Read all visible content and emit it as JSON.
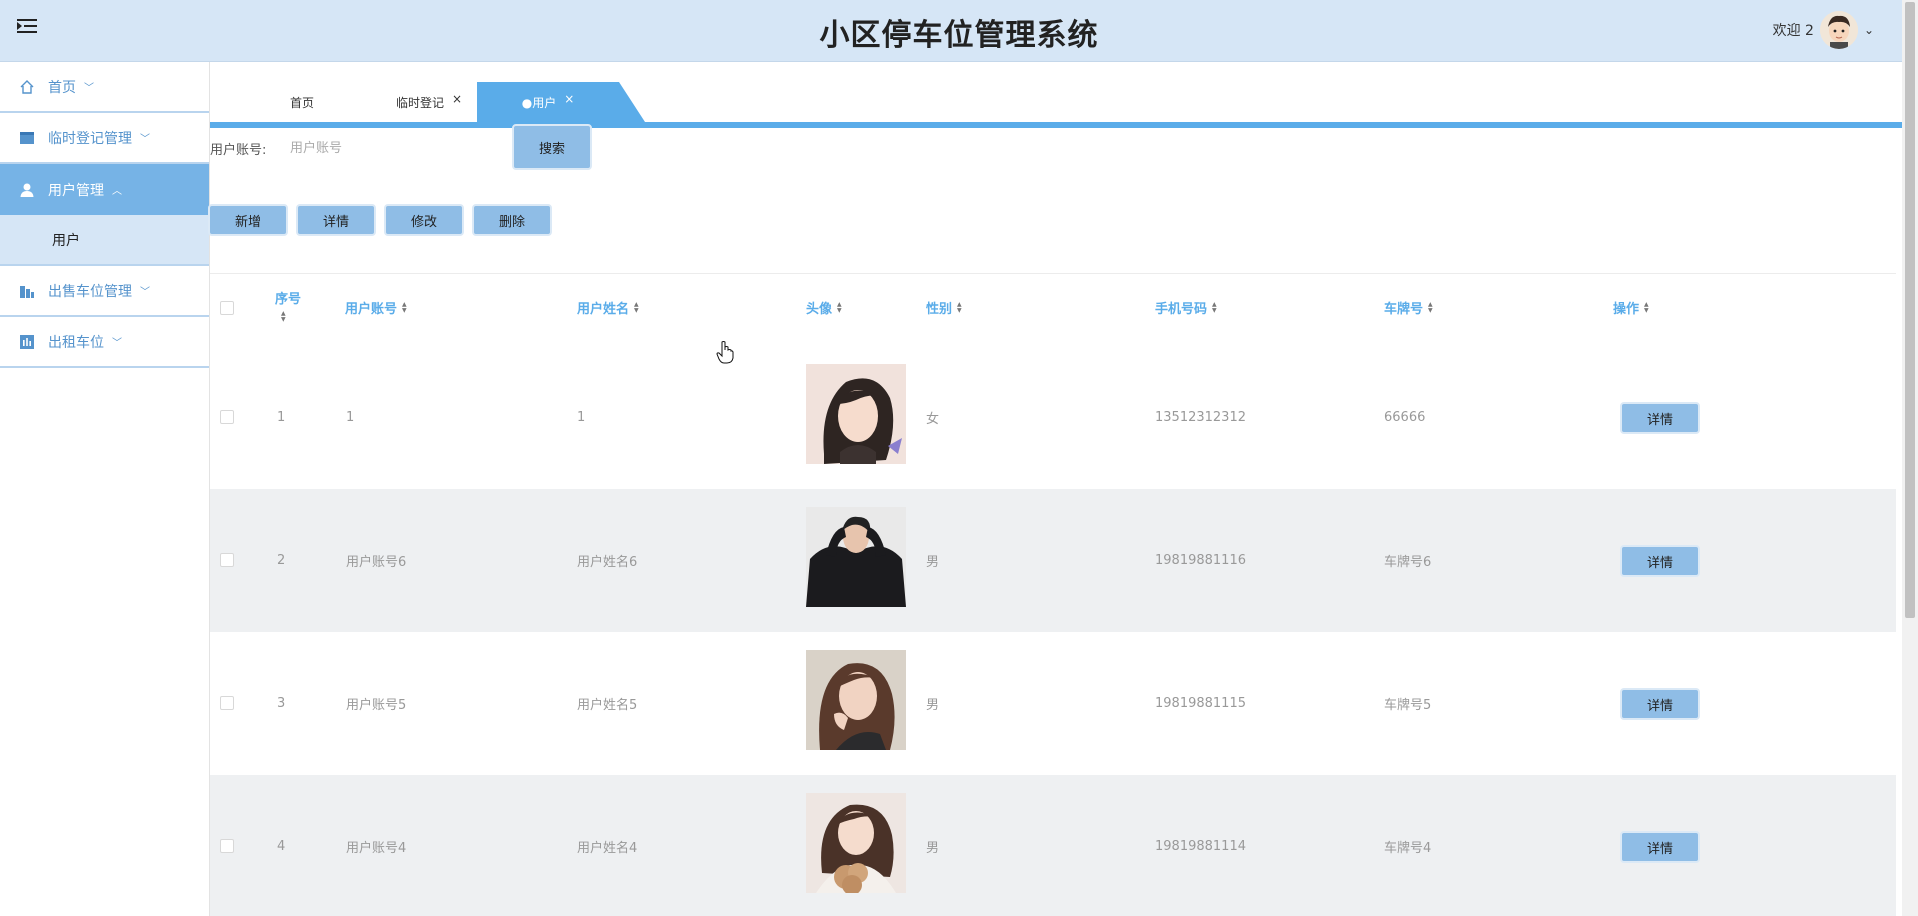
{
  "header": {
    "title": "小区停车位管理系统",
    "welcome": "欢迎 2",
    "caret": "⌄"
  },
  "sidebar": {
    "items": [
      {
        "label": "首页",
        "icon": "home-icon"
      },
      {
        "label": "临时登记管理",
        "icon": "register-icon"
      },
      {
        "label": "用户管理",
        "icon": "user-icon",
        "active": true,
        "sub": [
          {
            "label": "用户"
          }
        ]
      },
      {
        "label": "出售车位管理",
        "icon": "building-icon"
      },
      {
        "label": "出租车位",
        "icon": "rent-icon"
      }
    ]
  },
  "tabs": [
    {
      "label": "首页",
      "closable": false
    },
    {
      "label": "临时登记",
      "closable": true
    },
    {
      "label": "●用户",
      "closable": true,
      "active": true
    }
  ],
  "tab_close": "×",
  "search": {
    "label": "用户账号:",
    "placeholder": "用户账号",
    "button": "搜索"
  },
  "actions": {
    "add": "新增",
    "detail": "详情",
    "edit": "修改",
    "delete": "删除"
  },
  "table": {
    "columns": [
      "序号",
      "用户账号",
      "用户姓名",
      "头像",
      "性别",
      "手机号码",
      "车牌号",
      "操作"
    ],
    "rows": [
      {
        "index": "1",
        "account": "1",
        "name": "1",
        "gender": "女",
        "phone": "13512312312",
        "plate": "66666",
        "action": "详情"
      },
      {
        "index": "2",
        "account": "用户账号6",
        "name": "用户姓名6",
        "gender": "男",
        "phone": "19819881116",
        "plate": "车牌号6",
        "action": "详情"
      },
      {
        "index": "3",
        "account": "用户账号5",
        "name": "用户姓名5",
        "gender": "男",
        "phone": "19819881115",
        "plate": "车牌号5",
        "action": "详情"
      },
      {
        "index": "4",
        "account": "用户账号4",
        "name": "用户姓名4",
        "gender": "男",
        "phone": "19819881114",
        "plate": "车牌号4",
        "action": "详情"
      }
    ]
  },
  "colors": {
    "header_bg": "#d6e6f6",
    "accent": "#5aace9",
    "nav_text": "#5593cc",
    "button_bg": "#8fbde6"
  }
}
